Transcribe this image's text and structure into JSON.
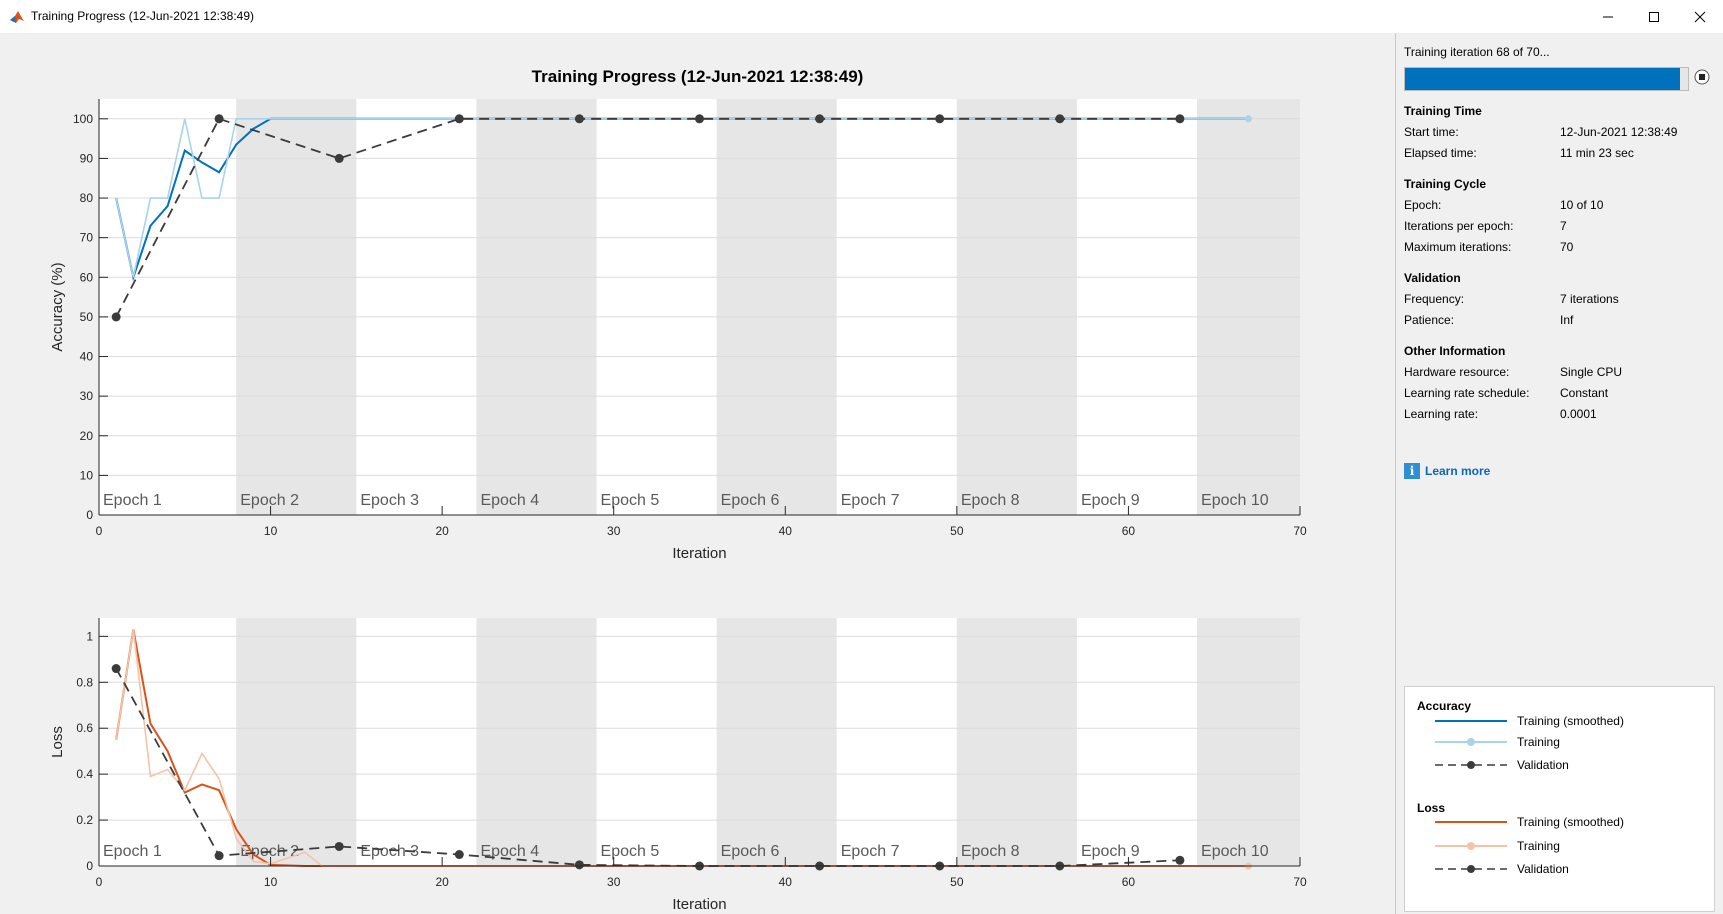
{
  "window": {
    "title": "Training Progress (12-Jun-2021 12:38:49)",
    "controls": [
      "minimize-icon",
      "maximize-icon",
      "close-icon"
    ]
  },
  "figure": {
    "title": "Training Progress (12-Jun-2021 12:38:49)"
  },
  "chart_data": [
    {
      "type": "line",
      "xlabel": "Iteration",
      "ylabel": "Accuracy (%)",
      "xlim": [
        0,
        70
      ],
      "ylim": [
        0,
        105
      ],
      "xticks": [
        0,
        10,
        20,
        30,
        40,
        50,
        60,
        70
      ],
      "yticks": [
        0,
        10,
        20,
        30,
        40,
        50,
        60,
        70,
        80,
        90,
        100
      ],
      "grid": true,
      "epochs": [
        "Epoch 1",
        "Epoch 2",
        "Epoch 3",
        "Epoch 4",
        "Epoch 5",
        "Epoch 6",
        "Epoch 7",
        "Epoch 8",
        "Epoch 9",
        "Epoch 10"
      ],
      "epoch_bounds": [
        0,
        8,
        15,
        22,
        29,
        36,
        43,
        50,
        57,
        64,
        70
      ],
      "series": [
        {
          "name": "Training (smoothed)",
          "color": "#0072bd",
          "style": "solid",
          "x": [
            1,
            2,
            3,
            4,
            5,
            6,
            7,
            8,
            9,
            10,
            12,
            15,
            20,
            30,
            40,
            50,
            60,
            67
          ],
          "y": [
            80,
            60,
            73,
            78,
            92,
            89,
            86.5,
            93.5,
            97.5,
            100,
            100,
            100,
            100,
            100,
            100,
            100,
            100,
            100
          ]
        },
        {
          "name": "Training",
          "color": "#a9d3ea",
          "style": "solid",
          "x": [
            1,
            2,
            3,
            4,
            5,
            6,
            7,
            8,
            9,
            10,
            15,
            20,
            30,
            40,
            50,
            60,
            67
          ],
          "y": [
            80,
            60,
            80,
            80,
            100,
            80,
            80,
            100,
            100,
            100,
            100,
            100,
            100,
            100,
            100,
            100,
            100
          ]
        },
        {
          "name": "Validation",
          "color": "#3b3b3b",
          "style": "dashed",
          "x": [
            1,
            7,
            14,
            21,
            28,
            35,
            42,
            49,
            56,
            63
          ],
          "y": [
            50,
            100,
            90,
            100,
            100,
            100,
            100,
            100,
            100,
            100
          ]
        }
      ]
    },
    {
      "type": "line",
      "xlabel": "Iteration",
      "ylabel": "Loss",
      "xlim": [
        0,
        70
      ],
      "ylim": [
        0,
        1.08
      ],
      "xticks": [
        0,
        10,
        20,
        30,
        40,
        50,
        60,
        70
      ],
      "yticks": [
        0,
        0.2,
        0.4,
        0.6,
        0.8,
        1
      ],
      "grid": true,
      "epochs": [
        "Epoch 1",
        "Epoch 2",
        "Epoch 3",
        "Epoch 4",
        "Epoch 5",
        "Epoch 6",
        "Epoch 7",
        "Epoch 8",
        "Epoch 9",
        "Epoch 10"
      ],
      "epoch_bounds": [
        0,
        8,
        15,
        22,
        29,
        36,
        43,
        50,
        57,
        64,
        70
      ],
      "series": [
        {
          "name": "Training (smoothed)",
          "color": "#d95319",
          "style": "solid",
          "x": [
            1,
            2,
            3,
            4,
            5,
            6,
            7,
            8,
            9,
            10,
            12,
            15,
            20,
            30,
            40,
            50,
            60,
            67
          ],
          "y": [
            0.55,
            1.03,
            0.62,
            0.5,
            0.32,
            0.355,
            0.33,
            0.16,
            0.05,
            0.005,
            0.0,
            0.0,
            0.0,
            0.0,
            0.0,
            0.0,
            0.0,
            0.0
          ]
        },
        {
          "name": "Training",
          "color": "#f4c3a8",
          "style": "solid",
          "x": [
            1,
            2,
            3,
            4,
            5,
            6,
            7,
            8,
            9,
            10,
            12,
            13,
            15,
            20,
            30,
            40,
            50,
            60,
            67
          ],
          "y": [
            0.55,
            1.03,
            0.39,
            0.42,
            0.33,
            0.49,
            0.38,
            0.12,
            0.02,
            0.01,
            0.06,
            0.0,
            0.0,
            0.0,
            0.0,
            0.0,
            0.0,
            0.0,
            0.0
          ]
        },
        {
          "name": "Validation",
          "color": "#3b3b3b",
          "style": "dashed",
          "x": [
            1,
            7,
            14,
            21,
            28,
            35,
            42,
            49,
            56,
            63
          ],
          "y": [
            0.86,
            0.045,
            0.085,
            0.05,
            0.005,
            0.0,
            0.0,
            0.0,
            0.0,
            0.025
          ]
        }
      ]
    }
  ],
  "panel": {
    "status": "Training iteration 68 of 70...",
    "progress": 0.97,
    "training_time": {
      "heading": "Training Time",
      "start_label": "Start time:",
      "start_value": "12-Jun-2021 12:38:49",
      "elapsed_label": "Elapsed time:",
      "elapsed_value": "11 min 23 sec"
    },
    "training_cycle": {
      "heading": "Training Cycle",
      "epoch_label": "Epoch:",
      "epoch_value": "10 of 10",
      "ipe_label": "Iterations per epoch:",
      "ipe_value": "7",
      "maxit_label": "Maximum iterations:",
      "maxit_value": "70"
    },
    "validation": {
      "heading": "Validation",
      "freq_label": "Frequency:",
      "freq_value": "7 iterations",
      "patience_label": "Patience:",
      "patience_value": "Inf"
    },
    "other": {
      "heading": "Other Information",
      "hw_label": "Hardware resource:",
      "hw_value": "Single CPU",
      "lrs_label": "Learning rate schedule:",
      "lrs_value": "Constant",
      "lr_label": "Learning rate:",
      "lr_value": "0.0001"
    },
    "learn_more": "Learn more"
  },
  "legend": {
    "accuracy_heading": "Accuracy",
    "loss_heading": "Loss",
    "items": [
      "Training (smoothed)",
      "Training",
      "Validation"
    ],
    "accuracy_colors": [
      "#0072bd",
      "#a9d3ea",
      "#3b3b3b"
    ],
    "loss_colors": [
      "#d95319",
      "#f4c3a8",
      "#3b3b3b"
    ]
  }
}
